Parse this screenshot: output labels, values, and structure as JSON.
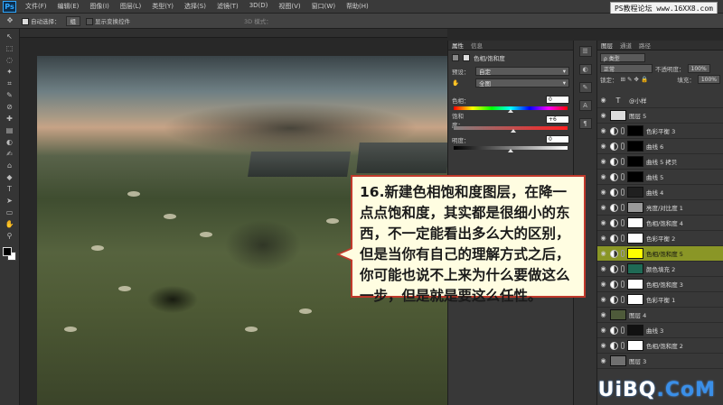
{
  "app": {
    "logo": "Ps"
  },
  "menu": [
    "文件(F)",
    "编辑(E)",
    "图像(I)",
    "图层(L)",
    "类型(Y)",
    "选择(S)",
    "滤镜(T)",
    "3D(D)",
    "视图(V)",
    "窗口(W)",
    "帮助(H)"
  ],
  "watermark_top": "PS教程论坛 www.16XX8.com",
  "options": {
    "auto_select_label": "自动选择：",
    "auto_select_value": "组",
    "show_transform_label": "显示变换控件",
    "mode_3d_label": "3D 模式："
  },
  "tools": [
    "↖",
    "⬚",
    "◌",
    "✦",
    "⌗",
    "✎",
    "⊘",
    "✚",
    "▤",
    "◐",
    "✍",
    "⌂",
    "◆",
    "T",
    "➤",
    "▭",
    "✋",
    "⚲"
  ],
  "properties": {
    "tabs": [
      "属性",
      "信息"
    ],
    "title": "色相/饱和度",
    "preset_label": "预设：",
    "preset_value": "自定",
    "channel_value": "全图",
    "hue_label": "色相：",
    "hue_value": "0",
    "saturation_label": "饱和度：",
    "saturation_value": "+6",
    "lightness_label": "明度：",
    "lightness_value": "0"
  },
  "callout": {
    "text": "16.新建色相饱和度图层，在降一点点饱和度，其实都是很细小的东西，不一定能看出多么大的区别，但是当你有自己的理解方式之后，你可能也说不上来为什么要做这么一步，但是就是要这么任性。"
  },
  "layers": {
    "tabs": [
      "图层",
      "通道",
      "路径"
    ],
    "filter_value": "ρ 类型",
    "blend_mode": "正常",
    "opacity_label": "不透明度：",
    "opacity_value": "100%",
    "lock_label": "锁定：",
    "fill_label": "填充：",
    "fill_value": "100%",
    "items": [
      {
        "name": "@小样",
        "type": "text",
        "selected": false,
        "thumb": "#383838"
      },
      {
        "name": "图层 5",
        "type": "pixel",
        "selected": false,
        "thumb": "#dddddd"
      },
      {
        "name": "色彩平衡 3",
        "type": "adj",
        "selected": false,
        "thumb": "#000000"
      },
      {
        "name": "曲线 6",
        "type": "adj",
        "selected": false,
        "thumb": "#000000"
      },
      {
        "name": "曲线 5 拷贝",
        "type": "adj",
        "selected": false,
        "thumb": "#000000"
      },
      {
        "name": "曲线 5",
        "type": "adj",
        "selected": false,
        "thumb": "#000000"
      },
      {
        "name": "曲线 4",
        "type": "adj",
        "selected": false,
        "thumb": "#202020"
      },
      {
        "name": "亮度/对比度 1",
        "type": "adj",
        "selected": false,
        "thumb": "#9a9a9a"
      },
      {
        "name": "色相/饱和度 4",
        "type": "adj",
        "selected": false,
        "thumb": "#ffffff"
      },
      {
        "name": "色彩平衡 2",
        "type": "adj",
        "selected": false,
        "thumb": "#ffffff"
      },
      {
        "name": "色相/饱和度 5",
        "type": "adj",
        "selected": true,
        "thumb": "#ffff00"
      },
      {
        "name": "颜色填充 2",
        "type": "fill",
        "selected": false,
        "thumb": "#1f6a55"
      },
      {
        "name": "色相/饱和度 3",
        "type": "adj",
        "selected": false,
        "thumb": "#ffffff"
      },
      {
        "name": "色彩平衡 1",
        "type": "adj",
        "selected": false,
        "thumb": "#ffffff"
      },
      {
        "name": "图层 4",
        "type": "pixel",
        "selected": false,
        "thumb": "#4e5a3a"
      },
      {
        "name": "曲线 3",
        "type": "adj",
        "selected": false,
        "thumb": "#111111"
      },
      {
        "name": "色相/饱和度 2",
        "type": "adj",
        "selected": false,
        "thumb": "#ffffff"
      },
      {
        "name": "图层 3",
        "type": "pixel",
        "selected": false,
        "thumb": "#707070"
      }
    ]
  },
  "bottom_watermark": {
    "prefix": "UiBQ",
    "suffix": ".CoM"
  }
}
